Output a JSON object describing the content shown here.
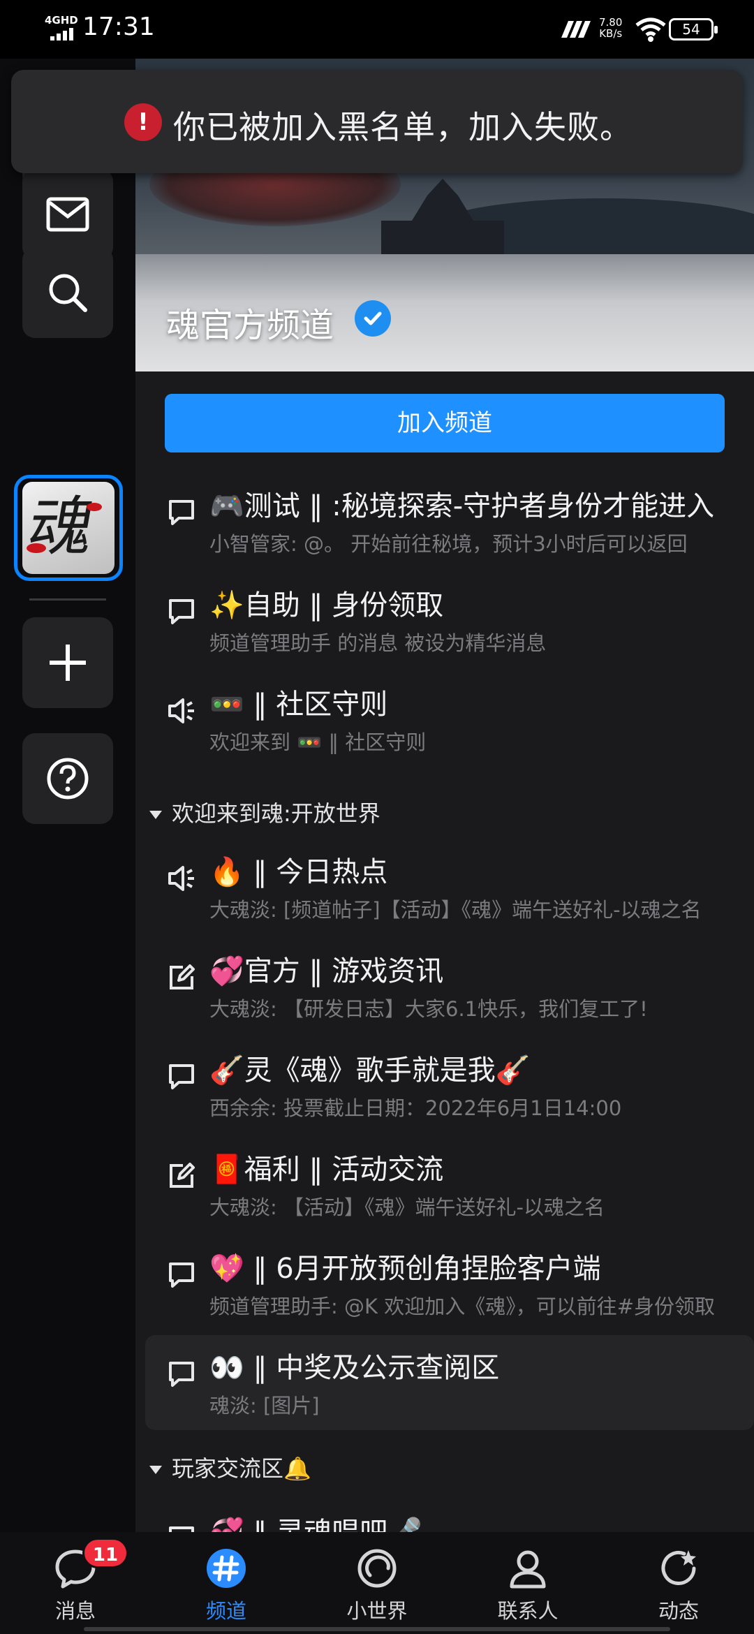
{
  "status_bar": {
    "network": "4GHD",
    "time": "17:31",
    "speed_value": "7.80",
    "speed_unit": "KB/s",
    "battery": "54"
  },
  "toast": {
    "message": "你已被加入黑名单，加入失败。"
  },
  "channel": {
    "name": "魂官方频道",
    "join_label": "加入频道"
  },
  "guild": {
    "icon_char": "魂"
  },
  "channels_top": [
    {
      "icon": "chat-icon",
      "name": "🎮测试 ‖ :秘境探索-守护者身份才能进入",
      "preview": "小智管家: @。 开始前往秘境，预计3小时后可以返回"
    },
    {
      "icon": "chat-icon",
      "name": "✨自助 ‖ 身份领取",
      "preview": "频道管理助手 的消息 被设为精华消息"
    },
    {
      "icon": "speaker-icon",
      "name": "🚥 ‖ 社区守则",
      "preview": "欢迎来到 🚥 ‖ 社区守则"
    }
  ],
  "group1": {
    "label": "欢迎来到魂:开放世界"
  },
  "channels_group1": [
    {
      "icon": "speaker-icon",
      "name": "🔥 ‖ 今日热点",
      "preview": "大魂淡: [频道帖子]【活动】《魂》端午送好礼-以魂之名"
    },
    {
      "icon": "post-icon",
      "name": "💞官方 ‖ 游戏资讯",
      "preview": "大魂淡: 【研发日志】大家6.1快乐，我们复工了!"
    },
    {
      "icon": "chat-icon",
      "name": "🎸灵《魂》歌手就是我🎸",
      "preview": "西余余: 投票截止日期：2022年6月1日14:00"
    },
    {
      "icon": "post-icon",
      "name": "🧧福利 ‖ 活动交流",
      "preview": "大魂淡: 【活动】《魂》端午送好礼-以魂之名"
    },
    {
      "icon": "chat-icon",
      "name": "💖 ‖ 6月开放预创角捏脸客户端",
      "preview": "频道管理助手: @K 欢迎加入《魂》，可以前往#身份领取"
    },
    {
      "icon": "chat-icon",
      "name": "👀 ‖ 中奖及公示查阅区",
      "preview": "魂淡: [图片]"
    }
  ],
  "group2": {
    "label": "玩家交流区🔔"
  },
  "channels_group2_partial": [
    {
      "name": "💞 ‖ 灵魂唱吧🎤"
    }
  ],
  "tabbar": {
    "tabs": [
      {
        "label": "消息",
        "icon": "message-icon",
        "badge": "11"
      },
      {
        "label": "频道",
        "icon": "hash-icon",
        "active": true
      },
      {
        "label": "小世界",
        "icon": "world-icon"
      },
      {
        "label": "联系人",
        "icon": "contacts-icon"
      },
      {
        "label": "动态",
        "icon": "activity-icon"
      }
    ]
  },
  "colors": {
    "accent": "#1e90ff",
    "badge": "#f02b3c",
    "warning": "#c8202e",
    "background": "#1a1a1c"
  }
}
